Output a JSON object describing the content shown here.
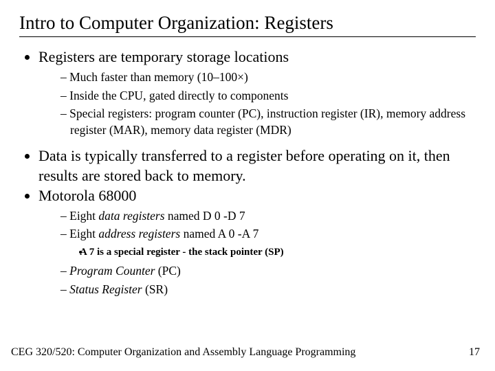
{
  "title": "Intro to Computer Organization: Registers",
  "bullets": {
    "b1": "Registers are temporary storage locations",
    "b1_subs": {
      "s1": "Much faster than memory (10–100×)",
      "s2": "Inside the CPU, gated directly to components",
      "s3": "Special registers: program counter (PC), instruction register (IR), memory address register (MAR), memory data register (MDR)"
    },
    "b2": "Data is typically transferred to a register before operating on it, then results are stored back to memory.",
    "b3": "Motorola 68000",
    "b3_subs": {
      "s1_pre": "Eight ",
      "s1_em": "data registers",
      "s1_post": " named D 0 -D 7",
      "s2_pre": "Eight ",
      "s2_em": "address registers",
      "s2_post": " named A 0 -A 7",
      "s2_sub": "A 7 is a special register - the stack pointer (SP)",
      "s3_em": "Program Counter",
      "s3_post": " (PC)",
      "s4_em": "Status Register",
      "s4_post": " (SR)"
    }
  },
  "footer": {
    "course": "CEG 320/520: Computer Organization and Assembly Language Programming",
    "page": "17"
  }
}
